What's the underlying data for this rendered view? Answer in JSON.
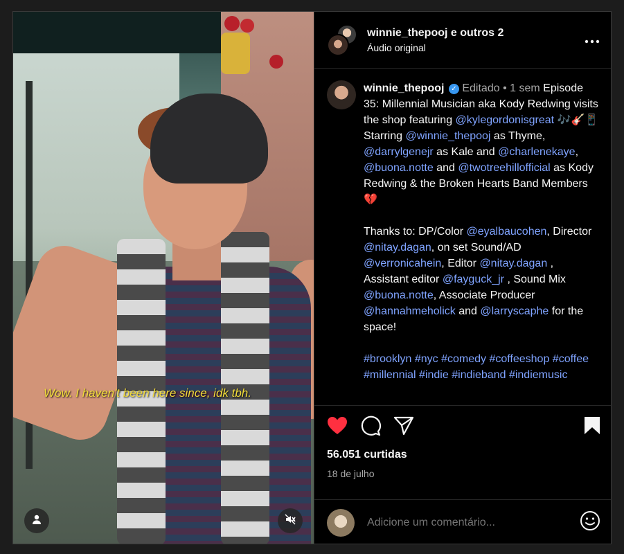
{
  "media": {
    "subtitle": "Wow. I haven't been here since, idk tbh."
  },
  "header": {
    "title": "winnie_thepooj e outros 2",
    "audio": "Áudio original",
    "more_icon": "more-horizontal-icon"
  },
  "caption": {
    "username": "winnie_thepooj",
    "edited": "Editado",
    "dot": "•",
    "time": "1 sem",
    "p1": [
      {
        "t": "Episode 35: Millennial Musician aka Kody Redwing visits the shop featuring "
      },
      {
        "t": "@kylegordonisgreat",
        "link": true
      },
      {
        "t": " 🎶🎸📱 Starring "
      },
      {
        "t": "@winnie_thepooj",
        "link": true
      },
      {
        "t": " as Thyme, "
      },
      {
        "t": "@darrylgenejr",
        "link": true
      },
      {
        "t": " as Kale and "
      },
      {
        "t": "@charlenekaye",
        "link": true
      },
      {
        "t": ", "
      },
      {
        "t": "@buona.notte",
        "link": true
      },
      {
        "t": " and "
      },
      {
        "t": "@twotreehillofficial",
        "link": true
      },
      {
        "t": " as Kody Redwing & the Broken Hearts Band Members 💔"
      }
    ],
    "p2": [
      {
        "t": "Thanks to: DP/Color "
      },
      {
        "t": "@eyalbaucohen",
        "link": true
      },
      {
        "t": ", Director "
      },
      {
        "t": "@nitay.dagan",
        "link": true
      },
      {
        "t": ", on set Sound/AD "
      },
      {
        "t": "@verronicahein",
        "link": true
      },
      {
        "t": ", Editor "
      },
      {
        "t": "@nitay.dagan",
        "link": true
      },
      {
        "t": " , Assistant editor "
      },
      {
        "t": "@fayguck_jr",
        "link": true
      },
      {
        "t": " , Sound Mix "
      },
      {
        "t": "@buona.notte",
        "link": true
      },
      {
        "t": ", Associate Producer "
      },
      {
        "t": "@hannahmeholick",
        "link": true
      },
      {
        "t": " and "
      },
      {
        "t": "@larryscaphe",
        "link": true
      },
      {
        "t": " for the space!"
      }
    ],
    "p3": [
      {
        "t": "#brooklyn",
        "link": true
      },
      {
        "t": " "
      },
      {
        "t": "#nyc",
        "link": true
      },
      {
        "t": " "
      },
      {
        "t": "#comedy",
        "link": true
      },
      {
        "t": " "
      },
      {
        "t": "#coffeeshop",
        "link": true
      },
      {
        "t": " "
      },
      {
        "t": "#coffee",
        "link": true
      },
      {
        "t": " "
      },
      {
        "t": "#millennial",
        "link": true
      },
      {
        "t": " "
      },
      {
        "t": "#indie",
        "link": true
      },
      {
        "t": " "
      },
      {
        "t": "#indieband",
        "link": true
      },
      {
        "t": " "
      },
      {
        "t": "#indiemusic",
        "link": true
      }
    ]
  },
  "actions": {
    "likes": "56.051 curtidas",
    "date": "18 de julho",
    "liked": true,
    "like_color": "#ff3040"
  },
  "comment": {
    "placeholder": "Adicione um comentário..."
  },
  "colors": {
    "link": "#7fa3ff",
    "verified": "#3897f0"
  }
}
